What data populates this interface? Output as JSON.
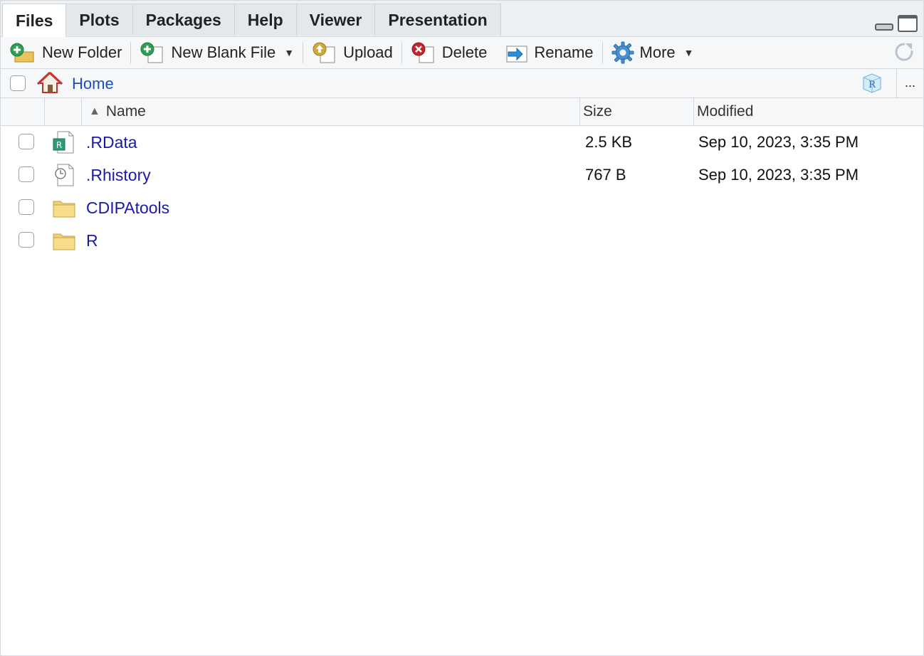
{
  "tabs": [
    {
      "label": "Files",
      "active": true
    },
    {
      "label": "Plots"
    },
    {
      "label": "Packages"
    },
    {
      "label": "Help"
    },
    {
      "label": "Viewer"
    },
    {
      "label": "Presentation"
    }
  ],
  "toolbar": {
    "new_folder": "New Folder",
    "new_blank_file": "New Blank File",
    "upload": "Upload",
    "delete": "Delete",
    "rename": "Rename",
    "more": "More"
  },
  "path": {
    "home": "Home",
    "more": "..."
  },
  "columns": {
    "name": "Name",
    "size": "Size",
    "modified": "Modified"
  },
  "files": [
    {
      "name": ".RData",
      "size": "2.5 KB",
      "modified": "Sep 10, 2023, 3:35 PM",
      "icon": "rdata-file-icon"
    },
    {
      "name": ".Rhistory",
      "size": "767 B",
      "modified": "Sep 10, 2023, 3:35 PM",
      "icon": "history-file-icon"
    },
    {
      "name": "CDIPAtools",
      "size": "",
      "modified": "",
      "icon": "folder-icon"
    },
    {
      "name": "R",
      "size": "",
      "modified": "",
      "icon": "folder-icon"
    }
  ],
  "colors": {
    "link": "#1a1aa8",
    "home_link": "#1a4fb4",
    "toolbar_bg": "#f6f7f9",
    "tabbar_bg": "#eef1f4"
  }
}
